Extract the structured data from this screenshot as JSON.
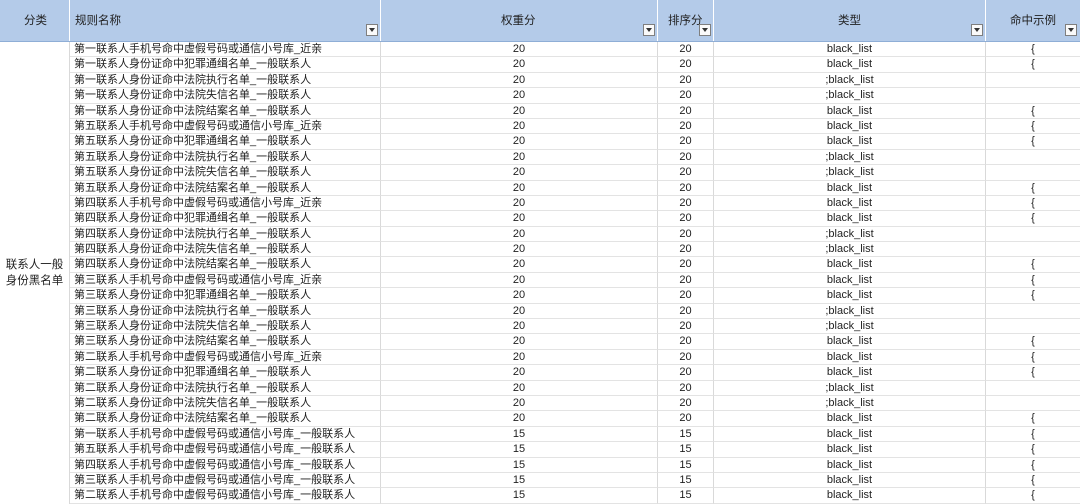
{
  "header": {
    "category": "分类",
    "name": "规则名称",
    "weight": "权重分",
    "sort": "排序分",
    "type": "类型",
    "example": "命中示例"
  },
  "category_lines": [
    "联系人一般",
    "身份黑名单"
  ],
  "rows": [
    {
      "name": "第一联系人手机号命中虚假号码或通信小号库_近亲",
      "weight": "20",
      "sort": "20",
      "type": "black_list",
      "example": "{"
    },
    {
      "name": "第一联系人身份证命中犯罪通缉名单_一般联系人",
      "weight": "20",
      "sort": "20",
      "type": "black_list",
      "example": "{"
    },
    {
      "name": "第一联系人身份证命中法院执行名单_一般联系人",
      "weight": "20",
      "sort": "20",
      "type": ";black_list",
      "example": ""
    },
    {
      "name": "第一联系人身份证命中法院失信名单_一般联系人",
      "weight": "20",
      "sort": "20",
      "type": ";black_list",
      "example": ""
    },
    {
      "name": "第一联系人身份证命中法院结案名单_一般联系人",
      "weight": "20",
      "sort": "20",
      "type": "black_list",
      "example": "{"
    },
    {
      "name": "第五联系人手机号命中虚假号码或通信小号库_近亲",
      "weight": "20",
      "sort": "20",
      "type": "black_list",
      "example": "{"
    },
    {
      "name": "第五联系人身份证命中犯罪通缉名单_一般联系人",
      "weight": "20",
      "sort": "20",
      "type": "black_list",
      "example": "{"
    },
    {
      "name": "第五联系人身份证命中法院执行名单_一般联系人",
      "weight": "20",
      "sort": "20",
      "type": ";black_list",
      "example": ""
    },
    {
      "name": "第五联系人身份证命中法院失信名单_一般联系人",
      "weight": "20",
      "sort": "20",
      "type": ";black_list",
      "example": ""
    },
    {
      "name": "第五联系人身份证命中法院结案名单_一般联系人",
      "weight": "20",
      "sort": "20",
      "type": "black_list",
      "example": "{"
    },
    {
      "name": "第四联系人手机号命中虚假号码或通信小号库_近亲",
      "weight": "20",
      "sort": "20",
      "type": "black_list",
      "example": "{"
    },
    {
      "name": "第四联系人身份证命中犯罪通缉名单_一般联系人",
      "weight": "20",
      "sort": "20",
      "type": "black_list",
      "example": "{"
    },
    {
      "name": "第四联系人身份证命中法院执行名单_一般联系人",
      "weight": "20",
      "sort": "20",
      "type": ";black_list",
      "example": ""
    },
    {
      "name": "第四联系人身份证命中法院失信名单_一般联系人",
      "weight": "20",
      "sort": "20",
      "type": ";black_list",
      "example": ""
    },
    {
      "name": "第四联系人身份证命中法院结案名单_一般联系人",
      "weight": "20",
      "sort": "20",
      "type": "black_list",
      "example": "{"
    },
    {
      "name": "第三联系人手机号命中虚假号码或通信小号库_近亲",
      "weight": "20",
      "sort": "20",
      "type": "black_list",
      "example": "{"
    },
    {
      "name": "第三联系人身份证命中犯罪通缉名单_一般联系人",
      "weight": "20",
      "sort": "20",
      "type": "black_list",
      "example": "{"
    },
    {
      "name": "第三联系人身份证命中法院执行名单_一般联系人",
      "weight": "20",
      "sort": "20",
      "type": ";black_list",
      "example": ""
    },
    {
      "name": "第三联系人身份证命中法院失信名单_一般联系人",
      "weight": "20",
      "sort": "20",
      "type": ";black_list",
      "example": ""
    },
    {
      "name": "第三联系人身份证命中法院结案名单_一般联系人",
      "weight": "20",
      "sort": "20",
      "type": "black_list",
      "example": "{"
    },
    {
      "name": "第二联系人手机号命中虚假号码或通信小号库_近亲",
      "weight": "20",
      "sort": "20",
      "type": "black_list",
      "example": "{"
    },
    {
      "name": "第二联系人身份证命中犯罪通缉名单_一般联系人",
      "weight": "20",
      "sort": "20",
      "type": "black_list",
      "example": "{"
    },
    {
      "name": "第二联系人身份证命中法院执行名单_一般联系人",
      "weight": "20",
      "sort": "20",
      "type": ";black_list",
      "example": ""
    },
    {
      "name": "第二联系人身份证命中法院失信名单_一般联系人",
      "weight": "20",
      "sort": "20",
      "type": ";black_list",
      "example": ""
    },
    {
      "name": "第二联系人身份证命中法院结案名单_一般联系人",
      "weight": "20",
      "sort": "20",
      "type": "black_list",
      "example": "{"
    },
    {
      "name": "第一联系人手机号命中虚假号码或通信小号库_一般联系人",
      "weight": "15",
      "sort": "15",
      "type": "black_list",
      "example": "{"
    },
    {
      "name": "第五联系人手机号命中虚假号码或通信小号库_一般联系人",
      "weight": "15",
      "sort": "15",
      "type": "black_list",
      "example": "{"
    },
    {
      "name": "第四联系人手机号命中虚假号码或通信小号库_一般联系人",
      "weight": "15",
      "sort": "15",
      "type": "black_list",
      "example": "{"
    },
    {
      "name": "第三联系人手机号命中虚假号码或通信小号库_一般联系人",
      "weight": "15",
      "sort": "15",
      "type": "black_list",
      "example": "{"
    },
    {
      "name": "第二联系人手机号命中虚假号码或通信小号库_一般联系人",
      "weight": "15",
      "sort": "15",
      "type": "black_list",
      "example": "{"
    }
  ]
}
